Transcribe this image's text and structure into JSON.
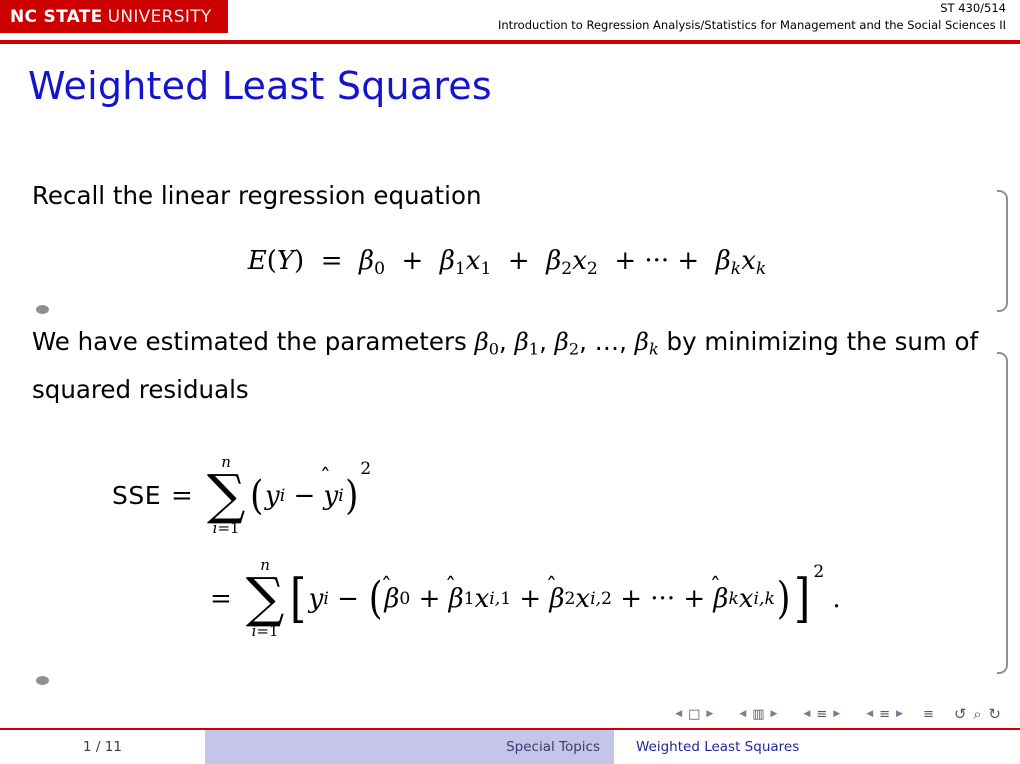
{
  "header": {
    "logo_bold": "NC STATE",
    "logo_light": "UNIVERSITY",
    "course_code": "ST 430/514",
    "course_title": "Introduction to Regression Analysis/Statistics for Management and the Social Sciences II"
  },
  "slide": {
    "title": "Weighted Least Squares",
    "paragraph1": "Recall the linear regression equation",
    "equation1": "E(Y) = β0 + β1x1 + β2x2 + ··· + βkxk",
    "paragraph2_part1": "We have estimated the parameters ",
    "paragraph2_params": "β0, β1, β2, …, βk",
    "paragraph2_part2": " by minimizing the sum of squared residuals",
    "sse_label": "SSE",
    "sse_line1": "SSE = ∑(i=1..n) (yi − ŷi)²",
    "sse_line2": "= ∑(i=1..n) [ yi − (β̂0 + β̂1xi,1 + β̂2xi,2 + ··· + β̂kxi,k) ]² ."
  },
  "navigation": {
    "first_symbol": "□",
    "second_symbol": "▥",
    "third_symbol": "≡",
    "fourth_symbol": "≡",
    "fifth_symbol": "≡",
    "back_symbol": "↺",
    "zoom_symbol": "⌕",
    "forward_symbol": "↻"
  },
  "footer": {
    "page": "1 / 11",
    "section": "Special Topics",
    "subsection": "Weighted Least Squares"
  }
}
